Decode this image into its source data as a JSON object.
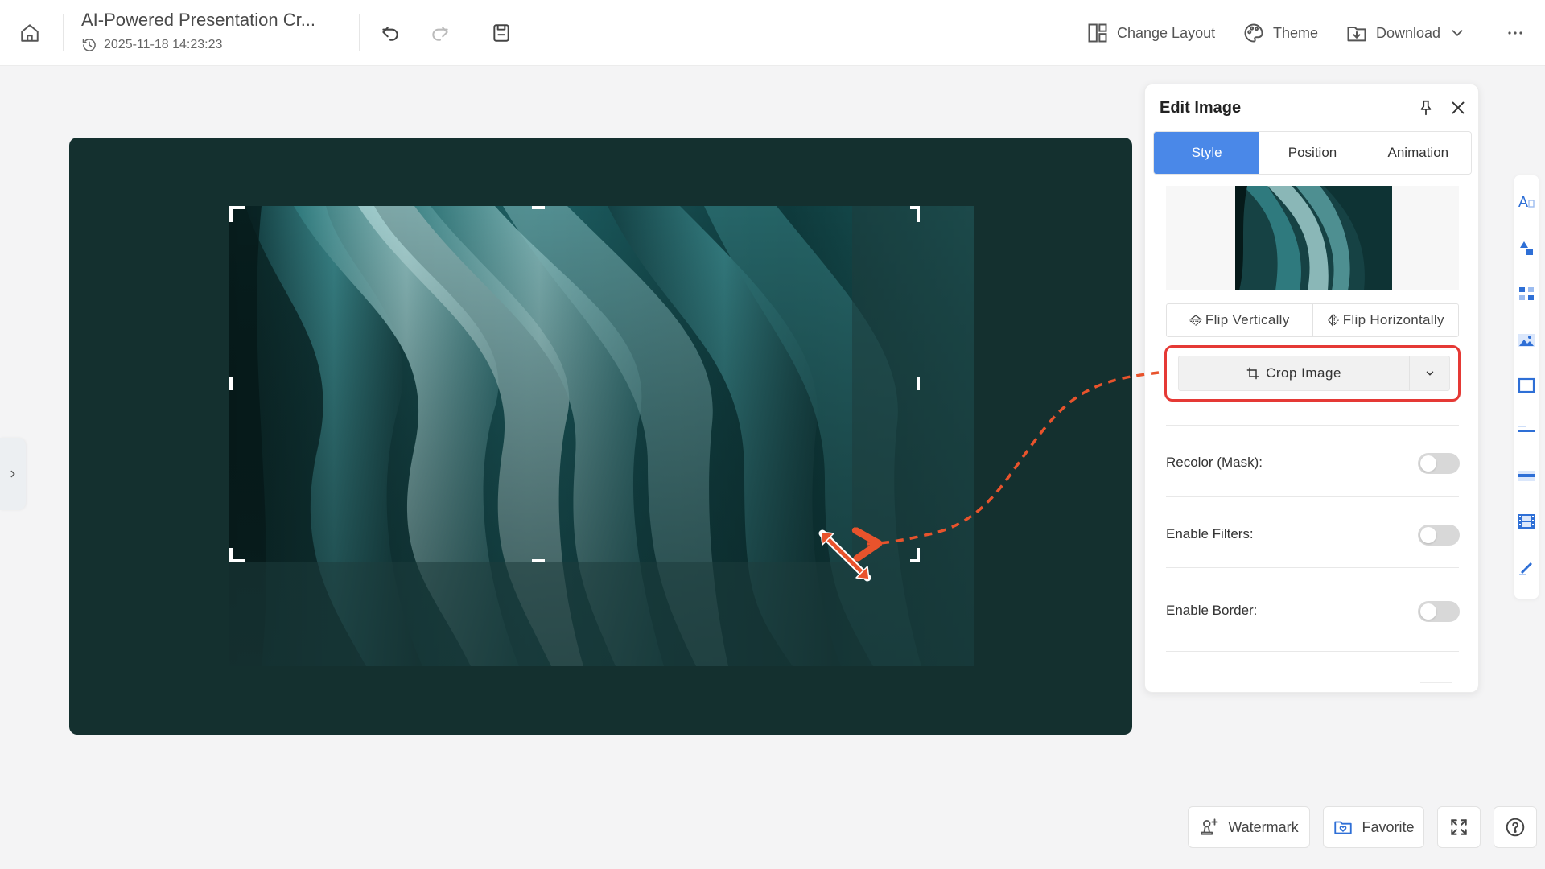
{
  "header": {
    "title": "AI-Powered Presentation Cr...",
    "timestamp": "2025-11-18 14:23:23",
    "actions": {
      "change_layout": "Change Layout",
      "theme": "Theme",
      "download": "Download"
    }
  },
  "panel": {
    "title": "Edit Image",
    "tabs": [
      "Style",
      "Position",
      "Animation"
    ],
    "active_tab": "Style",
    "flip_vertically": "Flip Vertically",
    "flip_horizontally": "Flip Horizontally",
    "crop_image": "Crop Image",
    "options": [
      {
        "label": "Recolor (Mask):",
        "enabled": false
      },
      {
        "label": "Enable Filters:",
        "enabled": false
      },
      {
        "label": "Enable Border:",
        "enabled": false
      }
    ]
  },
  "bottom": {
    "watermark": "Watermark",
    "favorite": "Favorite"
  },
  "colors": {
    "accent": "#4a88e8",
    "slide_bg": "#14302f",
    "highlight": "#e53935",
    "arrow": "#e8532c"
  },
  "icons": {
    "right_toolbar": [
      "text-icon",
      "shapes-icon",
      "components-icon",
      "image-icon",
      "frame-icon",
      "line-icon",
      "textbox-icon",
      "video-icon",
      "draw-icon"
    ]
  }
}
